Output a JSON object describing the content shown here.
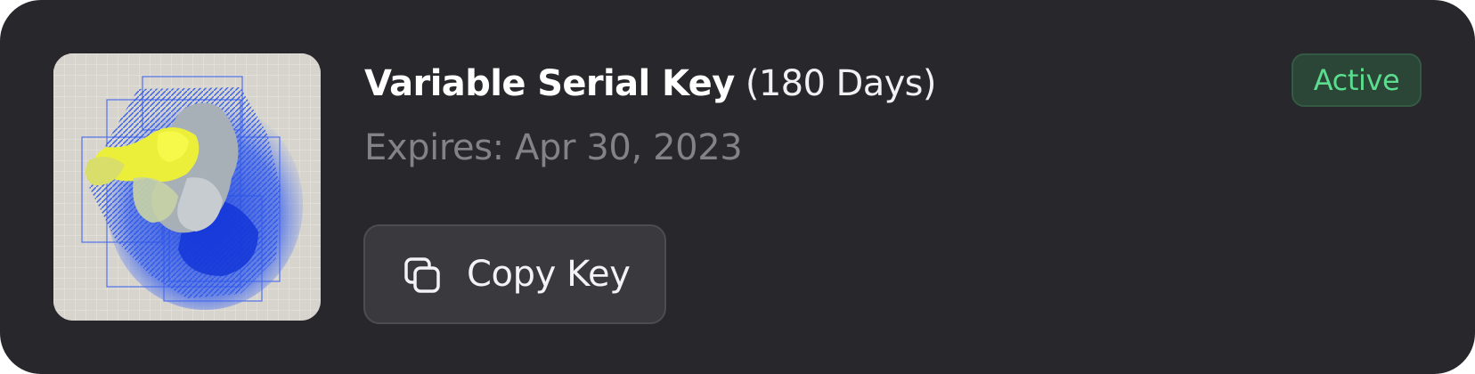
{
  "product": {
    "name": "Variable Serial Key",
    "duration": "(180 Days)",
    "expires": "Expires: Apr 30, 2023",
    "status": "Active",
    "thumbnail_icon": "coral-artwork-thumbnail"
  },
  "actions": {
    "copy_label": "Copy Key",
    "copy_icon": "copy-icon"
  },
  "colors": {
    "card_background": "#28272b",
    "status_text": "#5bdc8e",
    "status_background": "#2b4536",
    "muted_text": "#838287"
  }
}
